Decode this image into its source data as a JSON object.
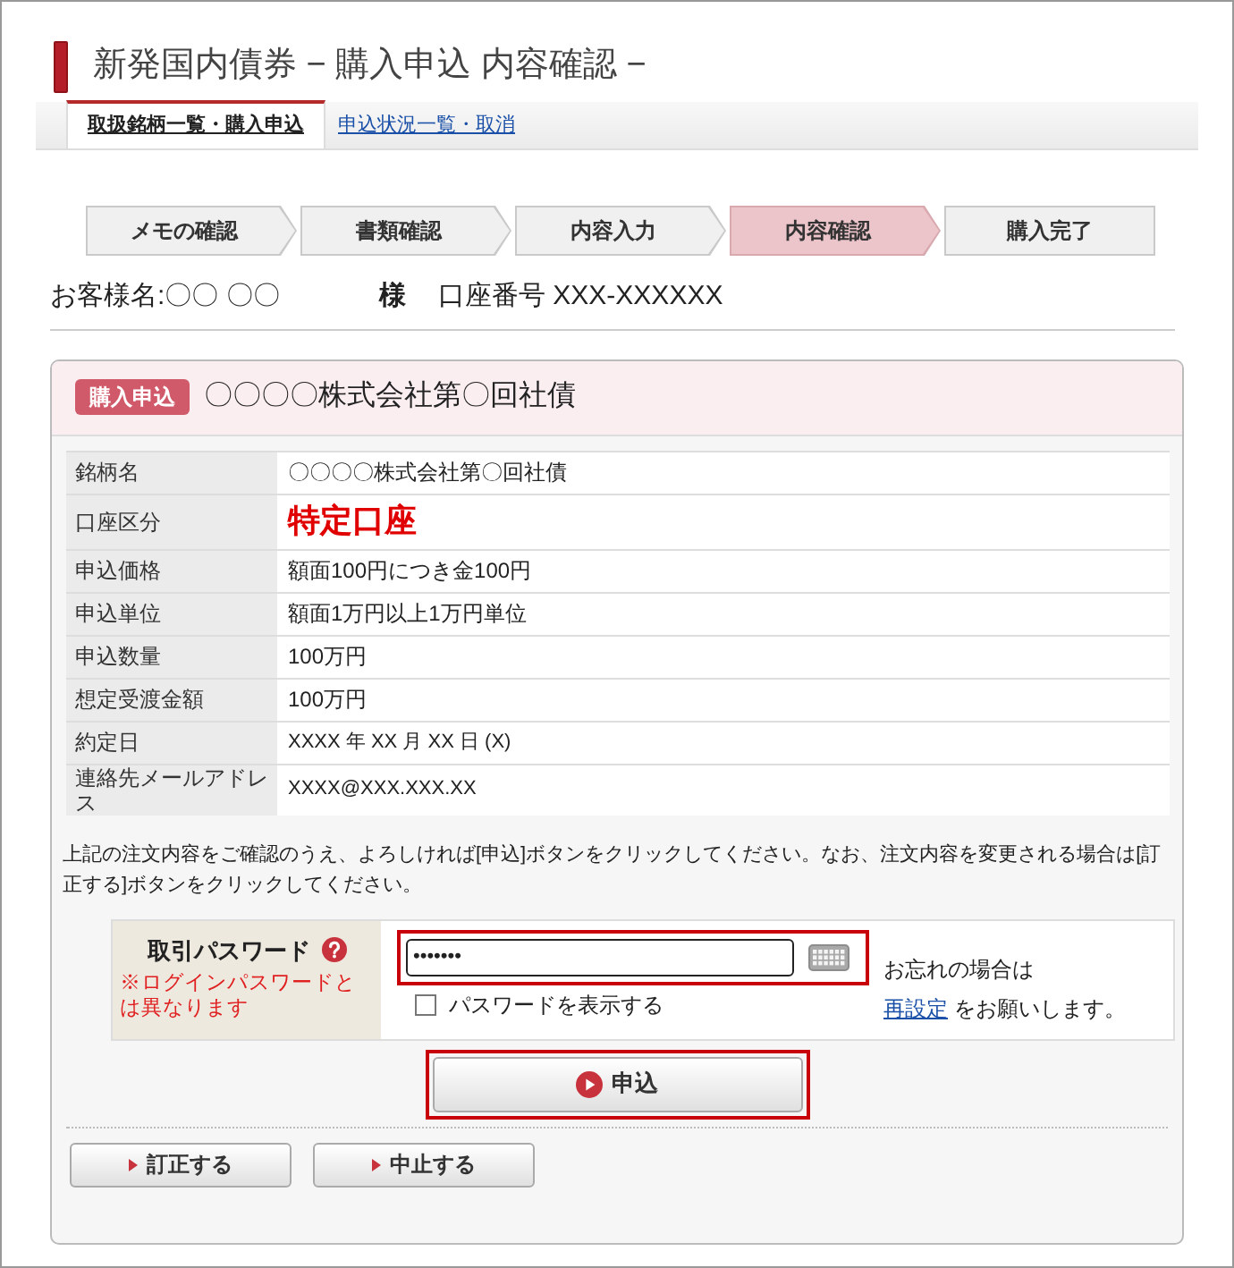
{
  "page_title": "新発国内債券 − 購入申込 内容確認 −",
  "tabs": [
    {
      "label": "取扱銘柄一覧・購入申込",
      "selected": true
    },
    {
      "label": "申込状況一覧・取消",
      "selected": false
    }
  ],
  "steps": [
    {
      "label": "メモの確認",
      "selected": false
    },
    {
      "label": "書類確認",
      "selected": false
    },
    {
      "label": "内容入力",
      "selected": false
    },
    {
      "label": "内容確認",
      "selected": true
    },
    {
      "label": "購入完了",
      "selected": false
    }
  ],
  "customer": {
    "name": "お客様名:〇〇 〇〇",
    "honorific": "様",
    "account": "口座番号 XXX-XXXXXX"
  },
  "order": {
    "badge": "購入申込",
    "title": "〇〇〇〇株式会社第〇回社債",
    "rows": [
      {
        "label": "銘柄名",
        "value": "〇〇〇〇株式会社第〇回社債",
        "kind": "text"
      },
      {
        "label": "口座区分",
        "value": "特定口座",
        "kind": "emphasis"
      },
      {
        "label": "申込価格",
        "value": "額面100円につき金100円",
        "kind": "text"
      },
      {
        "label": "申込単位",
        "value": "額面1万円以上1万円単位",
        "kind": "text"
      },
      {
        "label": "申込数量",
        "value": "100万円",
        "kind": "text"
      },
      {
        "label": "想定受渡金額",
        "value": "100万円",
        "kind": "text"
      },
      {
        "label": "約定日",
        "value": "XXXX 年 XX 月 XX 日 (X)",
        "kind": "small"
      },
      {
        "label": "連絡先メールアドレス",
        "value": "XXXX@XXX.XXX.XX",
        "kind": "small"
      }
    ]
  },
  "notice": "上記の注文内容をご確認のうえ、よろしければ[申込]ボタンをクリックしてください。なお、注文内容を変更される場合は[訂正する]ボタンをクリックしてください。",
  "password": {
    "label": "取引パスワード",
    "note": "※ログインパスワードとは異なります",
    "value": "•••••••",
    "highlighted": true,
    "show_password": {
      "label": "パスワードを表示する",
      "checked": false
    },
    "forgot": {
      "text": "お忘れの場合は",
      "link": "再設定",
      "after": "をお願いします。"
    }
  },
  "submit_button": {
    "label": "申込",
    "highlighted": true
  },
  "buttons": [
    {
      "label": "訂正する"
    },
    {
      "label": "中止する"
    }
  ]
}
